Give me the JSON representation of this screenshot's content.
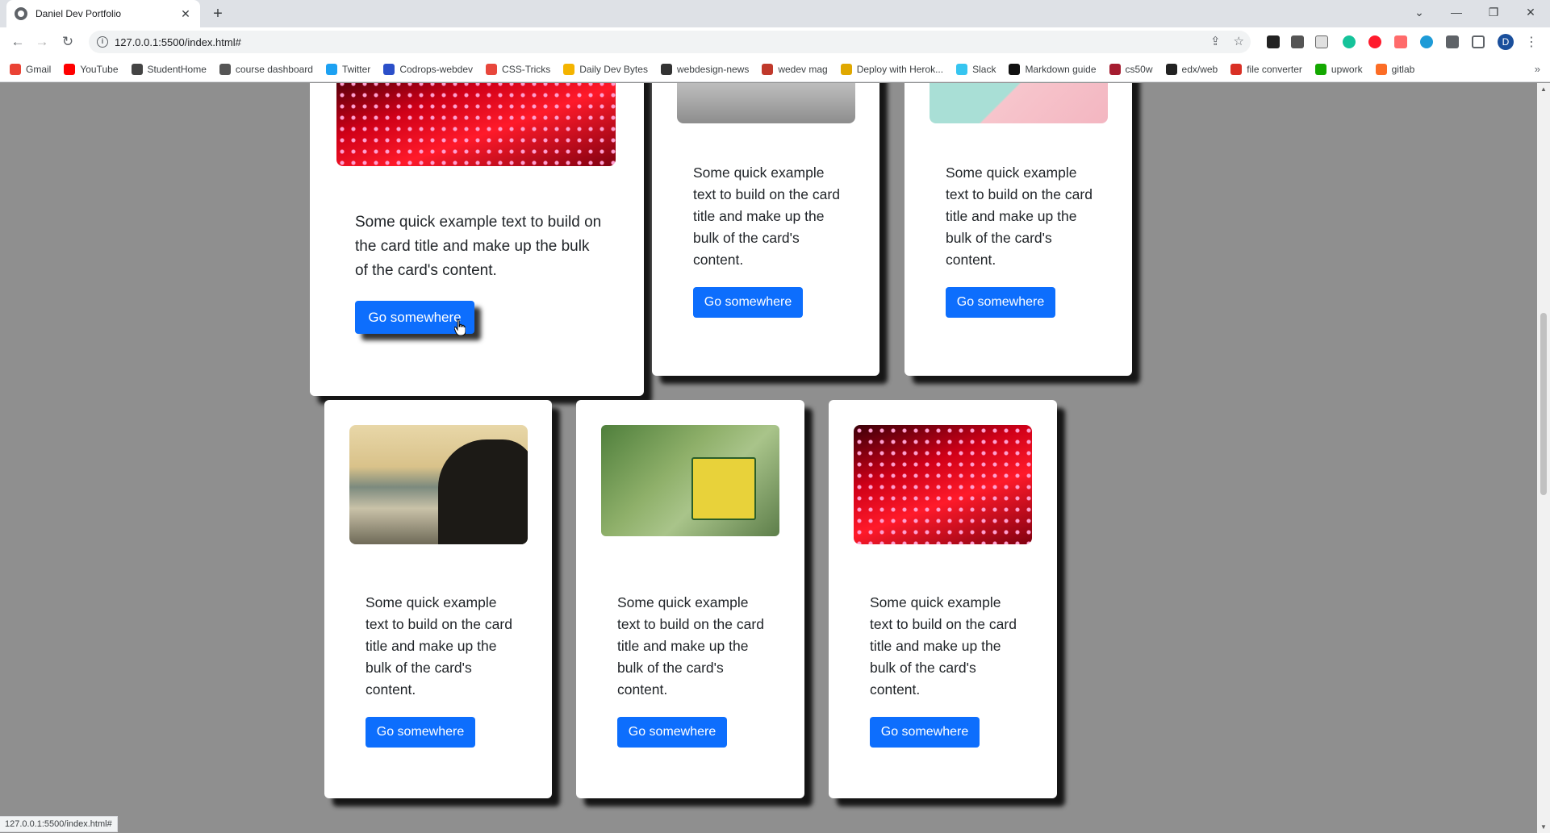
{
  "browser": {
    "tab_title": "Daniel Dev Portfolio",
    "url": "127.0.0.1:5500/index.html#",
    "status_url": "127.0.0.1:5500/index.html#",
    "profile_initial": "D",
    "bookmarks": [
      {
        "label": "Gmail",
        "color": "#ea4335"
      },
      {
        "label": "YouTube",
        "color": "#ff0000"
      },
      {
        "label": "StudentHome",
        "color": "#444444"
      },
      {
        "label": "course dashboard",
        "color": "#555555"
      },
      {
        "label": "Twitter",
        "color": "#1da1f2"
      },
      {
        "label": "Codrops-webdev",
        "color": "#2b4fc9"
      },
      {
        "label": "CSS-Tricks",
        "color": "#e8473c"
      },
      {
        "label": "Daily Dev Bytes",
        "color": "#f4b400"
      },
      {
        "label": "webdesign-news",
        "color": "#333333"
      },
      {
        "label": "wedev mag",
        "color": "#c0392b"
      },
      {
        "label": "Deploy with Herok...",
        "color": "#e0a800"
      },
      {
        "label": "Slack",
        "color": "#36c5f0"
      },
      {
        "label": "Markdown guide",
        "color": "#111111"
      },
      {
        "label": "cs50w",
        "color": "#a51c30"
      },
      {
        "label": "edx/web",
        "color": "#222222"
      },
      {
        "label": "file converter",
        "color": "#d93025"
      },
      {
        "label": "upwork",
        "color": "#14a800"
      },
      {
        "label": "gitlab",
        "color": "#fc6d26"
      }
    ]
  },
  "cards": [
    {
      "text": "Some quick example text to build on the card title and make up the bulk of the card's content.",
      "button": "Go somewhere"
    },
    {
      "text": "Some quick example text to build on the card title and make up the bulk of the card's content.",
      "button": "Go somewhere"
    },
    {
      "text": "Some quick example text to build on the card title and make up the bulk of the card's content.",
      "button": "Go somewhere"
    },
    {
      "text": "Some quick example text to build on the card title and make up the bulk of the card's content.",
      "button": "Go somewhere"
    },
    {
      "text": "Some quick example text to build on the card title and make up the bulk of the card's content.",
      "button": "Go somewhere"
    },
    {
      "text": "Some quick example text to build on the card title and make up the bulk of the card's content.",
      "button": "Go somewhere"
    }
  ],
  "colors": {
    "page_bg": "#8f8f8f",
    "button": "#0d6efd"
  }
}
